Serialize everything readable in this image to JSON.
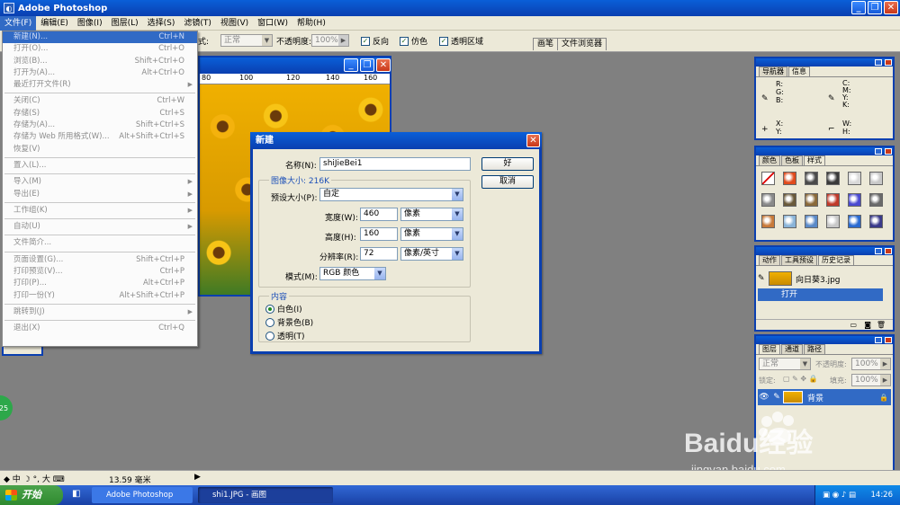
{
  "app": {
    "title": "Adobe Photoshop"
  },
  "menubar": [
    "文件(F)",
    "编辑(E)",
    "图像(I)",
    "图层(L)",
    "选择(S)",
    "滤镜(T)",
    "视图(V)",
    "窗口(W)",
    "帮助(H)"
  ],
  "options": {
    "style_label": "式:",
    "mode_value": "正常",
    "opacity_label": "不透明度:",
    "opacity_value": "100%",
    "reverse": "反向",
    "dither": "仿色",
    "transparency": "透明区域",
    "wells": [
      "画笔",
      "文件浏览器"
    ]
  },
  "file_menu": [
    {
      "label": "新建(N)...",
      "shortcut": "Ctrl+N",
      "sub": false
    },
    {
      "label": "打开(O)...",
      "shortcut": "Ctrl+O",
      "sub": false
    },
    {
      "label": "浏览(B)...",
      "shortcut": "Shift+Ctrl+O",
      "sub": false
    },
    {
      "label": "打开为(A)...",
      "shortcut": "Alt+Ctrl+O",
      "sub": false
    },
    {
      "label": "最近打开文件(R)",
      "shortcut": "",
      "sub": true
    },
    {
      "sep": true
    },
    {
      "label": "关闭(C)",
      "shortcut": "Ctrl+W",
      "sub": false
    },
    {
      "label": "存储(S)",
      "shortcut": "Ctrl+S",
      "sub": false
    },
    {
      "label": "存储为(A)...",
      "shortcut": "Shift+Ctrl+S",
      "sub": false
    },
    {
      "label": "存储为 Web 所用格式(W)...",
      "shortcut": "Alt+Shift+Ctrl+S",
      "sub": false
    },
    {
      "label": "恢复(V)",
      "shortcut": "",
      "sub": false
    },
    {
      "sep": true
    },
    {
      "label": "置入(L)...",
      "shortcut": "",
      "sub": false
    },
    {
      "sep": true
    },
    {
      "label": "导入(M)",
      "shortcut": "",
      "sub": true
    },
    {
      "label": "导出(E)",
      "shortcut": "",
      "sub": true
    },
    {
      "sep": true
    },
    {
      "label": "工作组(K)",
      "shortcut": "",
      "sub": true
    },
    {
      "sep": true
    },
    {
      "label": "自动(U)",
      "shortcut": "",
      "sub": true
    },
    {
      "sep": true
    },
    {
      "label": "文件简介...",
      "shortcut": "",
      "sub": false
    },
    {
      "sep": true
    },
    {
      "label": "页面设置(G)...",
      "shortcut": "Shift+Ctrl+P",
      "sub": false
    },
    {
      "label": "打印预览(V)...",
      "shortcut": "Ctrl+P",
      "sub": false
    },
    {
      "label": "打印(P)...",
      "shortcut": "Alt+Ctrl+P",
      "sub": false
    },
    {
      "label": "打印一份(Y)",
      "shortcut": "Alt+Shift+Ctrl+P",
      "sub": false
    },
    {
      "sep": true
    },
    {
      "label": "跳转到(J)",
      "shortcut": "",
      "sub": true
    },
    {
      "sep": true
    },
    {
      "label": "退出(X)",
      "shortcut": "Ctrl+Q",
      "sub": false
    }
  ],
  "doc": {
    "ruler_ticks": [
      "80",
      "100",
      "120",
      "140",
      "160"
    ]
  },
  "dialog": {
    "title": "新建",
    "name_label": "名称(N):",
    "name_value": "shiJieBei1",
    "ok": "好",
    "cancel": "取消",
    "image_size": "图像大小: 216K",
    "preset_label": "预设大小(P):",
    "preset_value": "自定",
    "width_label": "宽度(W):",
    "width_value": "460",
    "width_unit": "像素",
    "height_label": "高度(H):",
    "height_value": "160",
    "height_unit": "像素",
    "resolution_label": "分辨率(R):",
    "resolution_value": "72",
    "resolution_unit": "像素/英寸",
    "mode_label": "模式(M):",
    "mode_value": "RGB 颜色",
    "contents_label": "内容",
    "contents": [
      {
        "label": "白色(I)",
        "selected": true
      },
      {
        "label": "背景色(B)",
        "selected": false
      },
      {
        "label": "透明(T)",
        "selected": false
      }
    ]
  },
  "navigator_panel": {
    "tabs": [
      "导航器",
      "信息"
    ],
    "labels": {
      "rgb": "R:\nG:\nB:",
      "cmyk": "C:\nM:\nY:\nK:",
      "xy": "X:\nY:",
      "wh": "W:\nH:"
    }
  },
  "swatches_panel": {
    "tabs": [
      "颜色",
      "色板",
      "样式"
    ],
    "colors": [
      "#e6d9c8",
      "#e04a1c",
      "#4a4a4a",
      "#3a3a3a",
      "#d8d8d8",
      "#c8c8c8",
      "#8a8a8a",
      "#6a5a3a",
      "#8a6a3a",
      "#c03a2a",
      "#4a4ad0",
      "#6a6a6a",
      "#c87a3a",
      "#8ab4d8",
      "#5a8ac8",
      "#c8c8c8",
      "#2a6ad0",
      "#3a3a8a"
    ]
  },
  "history_panel": {
    "tabs": [
      "动作",
      "工具预设",
      "历史记录"
    ],
    "snapshot": "向日葵3.jpg",
    "step": "打开"
  },
  "layers_panel": {
    "tabs": [
      "图层",
      "通道",
      "路径"
    ],
    "blend": "正常",
    "opacity_label": "不透明度:",
    "opacity_value": "100%",
    "lock_label": "锁定:",
    "fill_label": "填充:",
    "fill_value": "100%",
    "layer_name": "背景"
  },
  "status": {
    "zoom": "13.59 毫米",
    "ime": "中",
    "ime_big": "大"
  },
  "taskbar": {
    "start": "开始",
    "tasks": [
      "Adobe Photoshop",
      "shi1.JPG - 画图"
    ],
    "clock": "14:26"
  },
  "misc": {
    "green_badge": "25",
    "watermark_logo": "Baidu经验",
    "watermark_url": "jingyan.baidu.com"
  }
}
